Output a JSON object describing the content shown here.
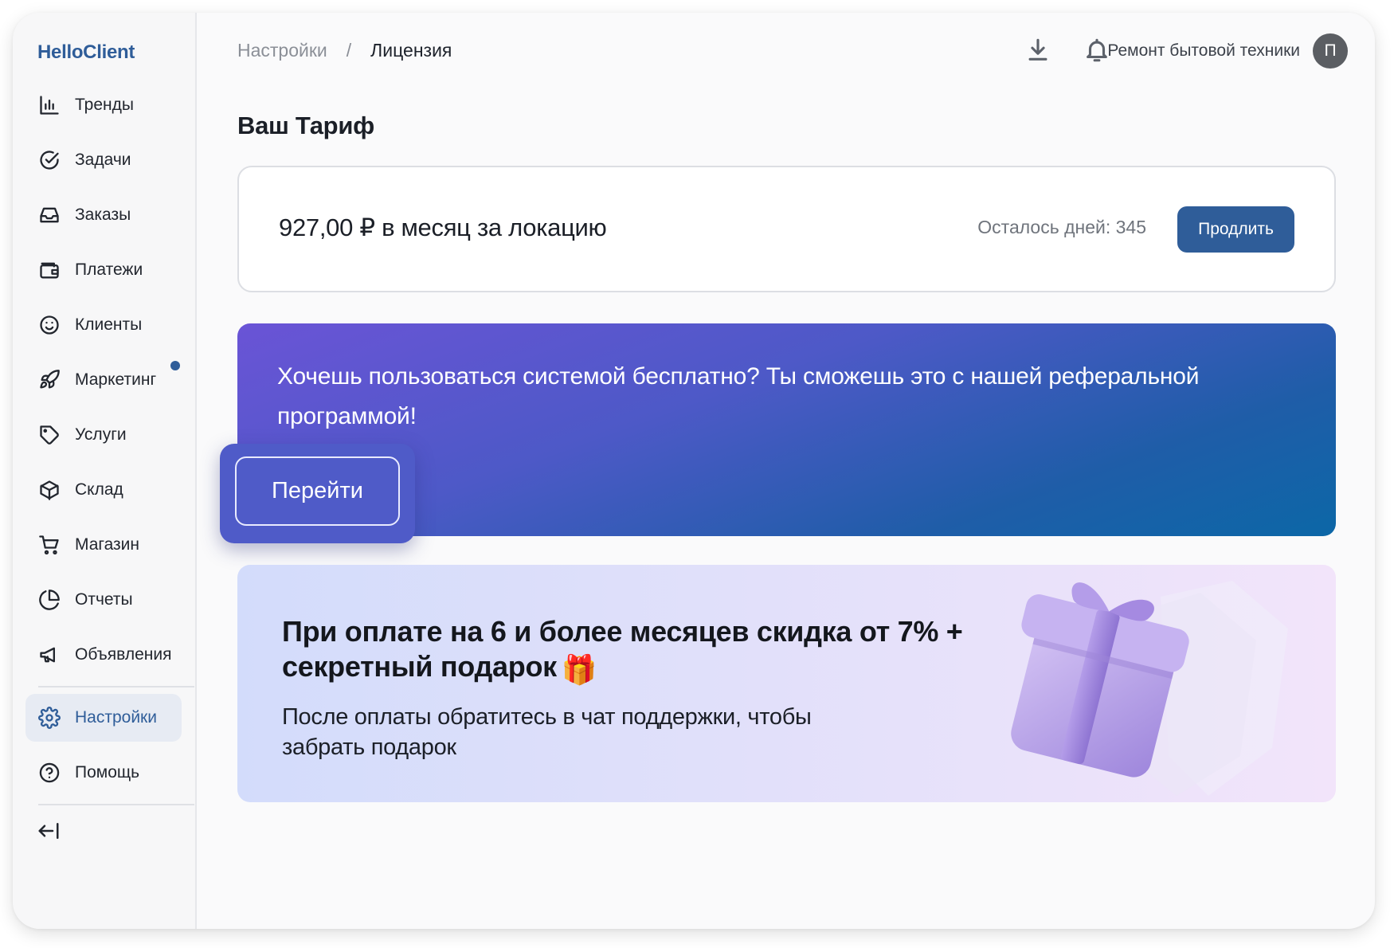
{
  "app": {
    "logo": "HelloClient"
  },
  "sidebar": {
    "items": [
      {
        "label": "Тренды",
        "icon": "bar-chart-icon"
      },
      {
        "label": "Задачи",
        "icon": "check-circle-icon"
      },
      {
        "label": "Заказы",
        "icon": "inbox-icon"
      },
      {
        "label": "Платежи",
        "icon": "wallet-icon"
      },
      {
        "label": "Клиенты",
        "icon": "smile-icon"
      },
      {
        "label": "Маркетинг",
        "icon": "rocket-icon",
        "notification": true
      },
      {
        "label": "Услуги",
        "icon": "tag-icon"
      },
      {
        "label": "Склад",
        "icon": "box-icon"
      },
      {
        "label": "Магазин",
        "icon": "cart-icon"
      },
      {
        "label": "Отчеты",
        "icon": "pie-chart-icon"
      },
      {
        "label": "Объявления",
        "icon": "megaphone-icon"
      }
    ],
    "bottom_items": [
      {
        "label": "Настройки",
        "icon": "gear-icon",
        "active": true
      },
      {
        "label": "Помощь",
        "icon": "help-circle-icon"
      }
    ],
    "collapse_icon": "collapse-left-icon"
  },
  "header": {
    "breadcrumb": {
      "parent": "Настройки",
      "separator": "/",
      "current": "Лицензия"
    },
    "company": "Ремонт бытовой техники",
    "avatar_initial": "П",
    "icons": [
      "download-icon",
      "bell-icon"
    ]
  },
  "tariff": {
    "section_title": "Ваш Тариф",
    "price": "927,00 ₽ в месяц за локацию",
    "days_left": "Осталось дней: 345",
    "extend_label": "Продлить"
  },
  "referral": {
    "text": "Хочешь пользоваться системой бесплатно? Ты сможешь это с нашей реферальной программой!",
    "button_label": "Перейти"
  },
  "promo": {
    "title": "При оплате на 6 и более месяцев скидка от 7% + секретный подарок",
    "title_emoji": "🎁",
    "subtitle": "После оплаты обратитесь в чат поддержки, чтобы забрать подарок"
  },
  "colors": {
    "accent": "#2f5d99",
    "referral_gradient_start": "#6a54d6",
    "referral_gradient_end": "#0c67a7",
    "promo_gradient_start": "#d3dcfb",
    "promo_gradient_end": "#f2e4fa"
  }
}
